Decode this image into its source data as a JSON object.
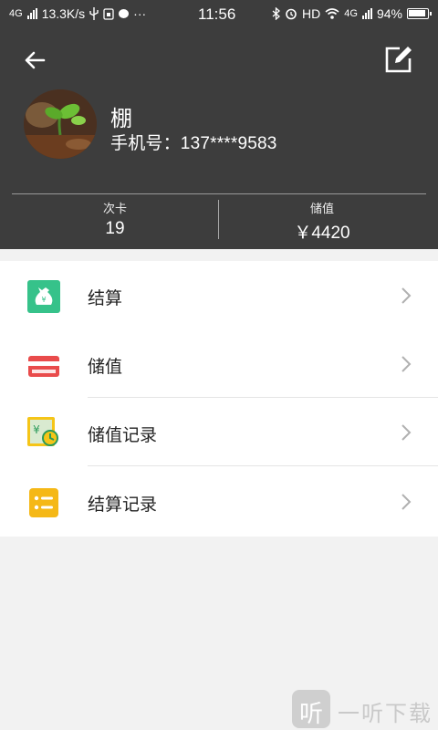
{
  "status_bar": {
    "network_left": "4G",
    "speed": "13.3K/s",
    "dots": "···",
    "time": "11:56",
    "hd": "HD",
    "network_right": "4G",
    "battery": "94%"
  },
  "profile": {
    "name": "棚",
    "phone": "手机号：137****9583"
  },
  "stats": [
    {
      "label": "次卡",
      "value": "19"
    },
    {
      "label": "储值",
      "value": "￥4420"
    }
  ],
  "menu": [
    {
      "label": "结算",
      "icon": "settlement-icon",
      "color": "#36c28a"
    },
    {
      "label": "储值",
      "icon": "card-icon",
      "color": "#e94b4b"
    },
    {
      "label": "储值记录",
      "icon": "deposit-record-icon",
      "color": "#f5c518"
    },
    {
      "label": "结算记录",
      "icon": "list-icon",
      "color": "#f5b816"
    }
  ],
  "watermark": {
    "icon_text": "听",
    "text": "一听下载"
  },
  "colors": {
    "header_bg": "#3d3d3d",
    "page_bg": "#f2f2f2"
  }
}
